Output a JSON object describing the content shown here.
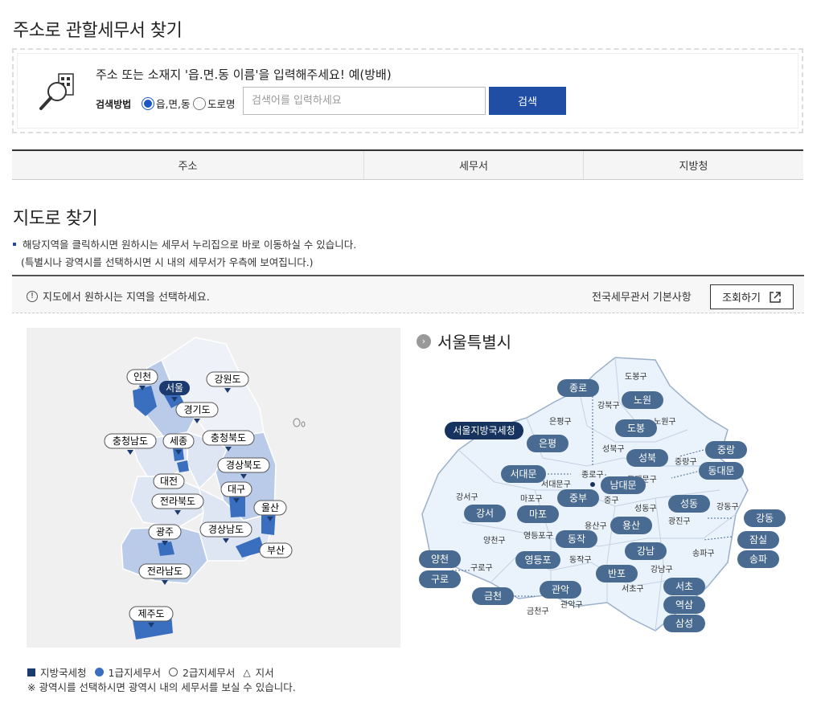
{
  "page": {
    "title": "주소로 관할세무서 찾기"
  },
  "search": {
    "guide": "주소 또는 소재지 '읍.면.동 이름'을 입력해주세요! 예(방배)",
    "method_label": "검색방법",
    "option_dong": "읍,면,동",
    "option_road": "도로명",
    "placeholder": "검색어를 입력하세요",
    "button": "검색"
  },
  "result_table": {
    "columns": [
      "주소",
      "세무서",
      "지방청"
    ]
  },
  "map_section": {
    "title": "지도로 찾기",
    "note1": "해당지역을 클릭하시면 원하시는 세무서 누리집으로 바로 이동하실 수 있습니다.",
    "note2": "(특별시나 광역시를 선택하시면 시 내의 세무서가 우측에 보여집니다.)",
    "select_hint": "지도에서 원하시는 지역을 선택하세요.",
    "basic_info": "전국세무관서 기본사항",
    "view_button": "조회하기"
  },
  "korea_map": {
    "regions": [
      "인천",
      "서울",
      "강원도",
      "경기도",
      "충청남도",
      "세종",
      "충청북도",
      "경상북도",
      "대전",
      "대구",
      "전라북도",
      "울산",
      "광주",
      "경상남도",
      "부산",
      "전라남도",
      "제주도"
    ]
  },
  "seoul_map": {
    "title": "서울특별시",
    "regional_office": "서울지방국세청",
    "offices": [
      "종로",
      "노원",
      "도봉",
      "은평",
      "서대문",
      "성북",
      "중랑",
      "동대문",
      "남대문",
      "중부",
      "강서",
      "마포",
      "성동",
      "강동",
      "용산",
      "동작",
      "잠실",
      "양천",
      "영등포",
      "강남",
      "송파",
      "구로",
      "반포",
      "서초",
      "금천",
      "관악",
      "역삼",
      "삼성"
    ],
    "districts": [
      "도봉구",
      "강북구",
      "노원구",
      "은평구",
      "성북구",
      "중랑구",
      "종로구",
      "서대문구",
      "동대문구",
      "마포구",
      "중구",
      "강서구",
      "성동구",
      "광진구",
      "강동구",
      "용산구",
      "영등포구",
      "양천구",
      "동작구",
      "송파구",
      "구로구",
      "강남구",
      "서초구",
      "금천구",
      "관악구"
    ]
  },
  "legend": {
    "regional": "지방국세청",
    "grade1": "1급지세무서",
    "grade2": "2급지세무서",
    "branch": "지서",
    "note": "※ 광역시를 선택하시면 광역시 내의 세무서를 보실 수 있습니다."
  },
  "colors": {
    "primary": "#204ea4",
    "label_dark": "#4a6b91",
    "label_navy": "#15335e"
  }
}
